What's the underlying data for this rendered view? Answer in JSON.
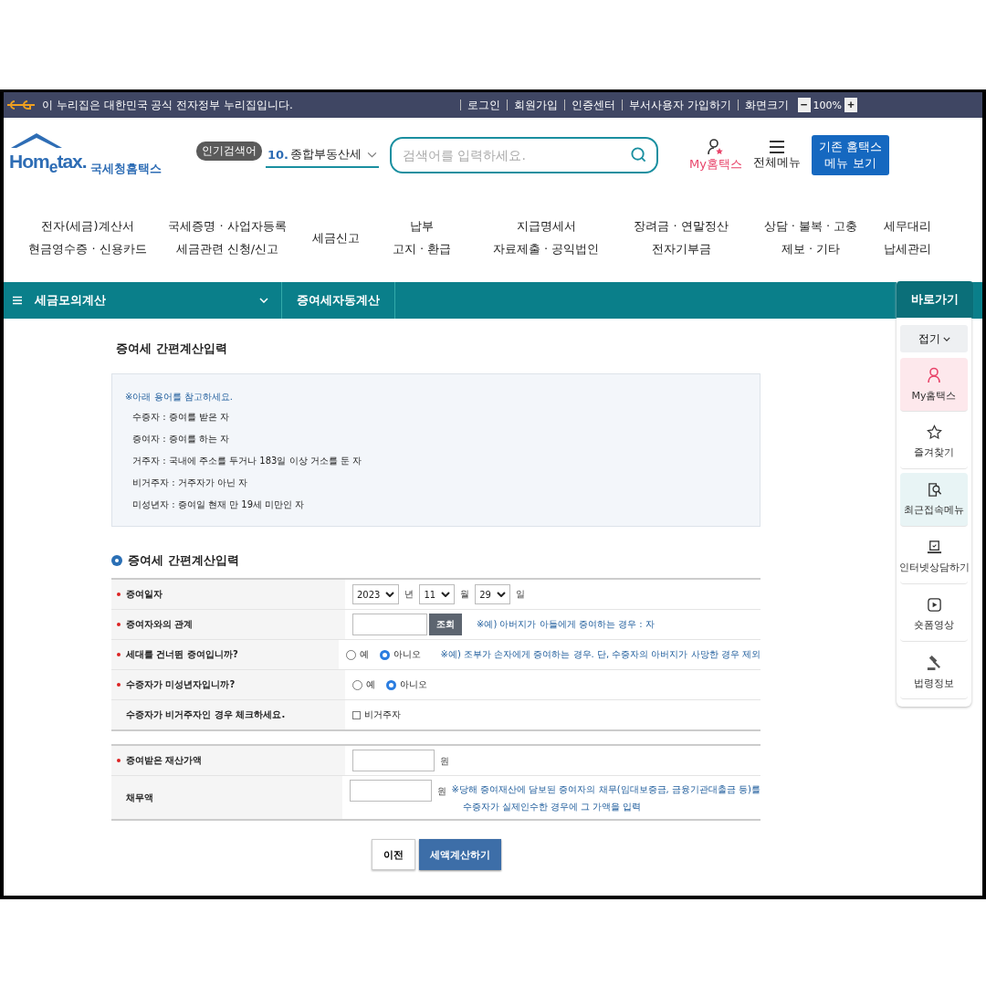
{
  "top_bar": {
    "notice": "이 누리집은 대한민국 공식 전자정부 누리집입니다.",
    "links": [
      "로그인",
      "회원가입",
      "인증센터",
      "부서사용자 가입하기",
      "화면크기"
    ],
    "zoom_out": "−",
    "zoom_level": "100%",
    "zoom_in": "+"
  },
  "header": {
    "logo_text": "Hom$_{e}$tax.",
    "logo_name": "국세청홈택스",
    "popular_label": "인기검색어",
    "popular_rank": "10.",
    "popular_term": "종합부동산세",
    "search": {
      "placeholder": "검색어를 입력하세요."
    },
    "my_label": "My홈택스",
    "menu_label": "전체메뉴",
    "legacy_button": [
      "기존 홈택스",
      "메뉴 보기"
    ]
  },
  "nav": [
    {
      "lines": [
        "전자(세금)계산서",
        "현금영수증 · 신용카드"
      ]
    },
    {
      "lines": [
        "국세증명 · 사업자등록",
        "세금관련 신청/신고"
      ]
    },
    {
      "lines": [
        "세금신고"
      ]
    },
    {
      "lines": [
        "납부",
        "고지 · 환급"
      ]
    },
    {
      "lines": [
        "지급명세서",
        "자료제출 · 공익법인"
      ]
    },
    {
      "lines": [
        "장려금 · 연말정산",
        "전자기부금"
      ]
    },
    {
      "lines": [
        "상담 · 불복 · 고충",
        "제보 · 기타"
      ]
    },
    {
      "lines": [
        "세무대리",
        "납세관리"
      ]
    }
  ],
  "breadcrumb": {
    "menu": "세금모의계산",
    "current": "증여세자동계산"
  },
  "page_title": "증여세 간편계산입력",
  "info": {
    "note": "※아래 용어를 참고하세요.",
    "terms": [
      "수증자 : 증여를 받은 자",
      "증여자 : 증여를 하는 자",
      "거주자 : 국내에 주소를 두거나 183일 이상 거소를 둔 자",
      "비거주자 : 거주자가 아닌 자",
      "미성년자 : 증여일 현재 만 19세 미만인 자"
    ]
  },
  "section_title": "증여세 간편계산입력",
  "form_rows": [
    {
      "kind": "date",
      "label": "증여일자",
      "required": true,
      "year": "2023",
      "year_unit": "년",
      "month": "11",
      "month_unit": "월",
      "day": "29",
      "day_unit": "일"
    },
    {
      "kind": "lookup",
      "label": "증여자와의 관계",
      "required": true,
      "button": "조회",
      "hint": "※예) 아버지가 아들에게 증여하는 경우 : 자"
    },
    {
      "kind": "radio",
      "label": "세대를 건너뛴 증여입니까?",
      "required": true,
      "options": [
        {
          "label": "예",
          "selected": false
        },
        {
          "label": "아니오",
          "selected": true
        }
      ],
      "hint": "※예) 조부가 손자에게 증여하는 경우. 단, 수증자의 아버지가 사망한 경우 제외"
    },
    {
      "kind": "radio",
      "label": "수증자가 미성년자입니까?",
      "required": true,
      "options": [
        {
          "label": "예",
          "selected": false
        },
        {
          "label": "아니오",
          "selected": true
        }
      ]
    },
    {
      "kind": "checkbox",
      "label": "수증자가 비거주자인 경우 체크하세요.",
      "required": false,
      "check_label": "비거주자",
      "checked": false
    }
  ],
  "amount_rows": [
    {
      "label": "증여받은 재산가액",
      "required": true,
      "unit": "원"
    },
    {
      "label": "채무액",
      "required": false,
      "unit": "원",
      "hint": [
        "※당해 증여재산에 담보된 증여자의 채무(임대보증금, 금융기관대출금 등)를",
        "수증자가 실제인수한 경우에 그 가액을 입력"
      ]
    }
  ],
  "buttons": {
    "back": "이전",
    "calculate": "세액계산하기"
  },
  "quick_panel": {
    "title": "바로가기",
    "fold": "접기",
    "items": [
      {
        "label": "My홈택스",
        "color": "#fde8ec"
      },
      {
        "label": "즐겨찾기"
      },
      {
        "label": "최근접속메뉴",
        "color": "#e8f4f5"
      },
      {
        "label": "인터넷상담하기"
      },
      {
        "label": "숏폼영상"
      },
      {
        "label": "법령정보"
      }
    ]
  }
}
